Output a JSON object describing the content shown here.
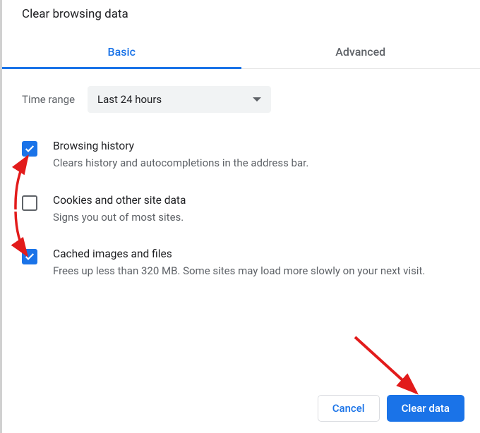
{
  "title": "Clear browsing data",
  "tabs": {
    "basic": "Basic",
    "advanced": "Advanced",
    "active": "basic"
  },
  "timerange": {
    "label": "Time range",
    "selected": "Last 24 hours"
  },
  "options": [
    {
      "checked": true,
      "title": "Browsing history",
      "desc": "Clears history and autocompletions in the address bar."
    },
    {
      "checked": false,
      "title": "Cookies and other site data",
      "desc": "Signs you out of most sites."
    },
    {
      "checked": true,
      "title": "Cached images and files",
      "desc": "Frees up less than 320 MB. Some sites may load more slowly on your next visit."
    }
  ],
  "buttons": {
    "cancel": "Cancel",
    "clear": "Clear data"
  },
  "annotation": {
    "arrow_color": "#e21b1b"
  }
}
